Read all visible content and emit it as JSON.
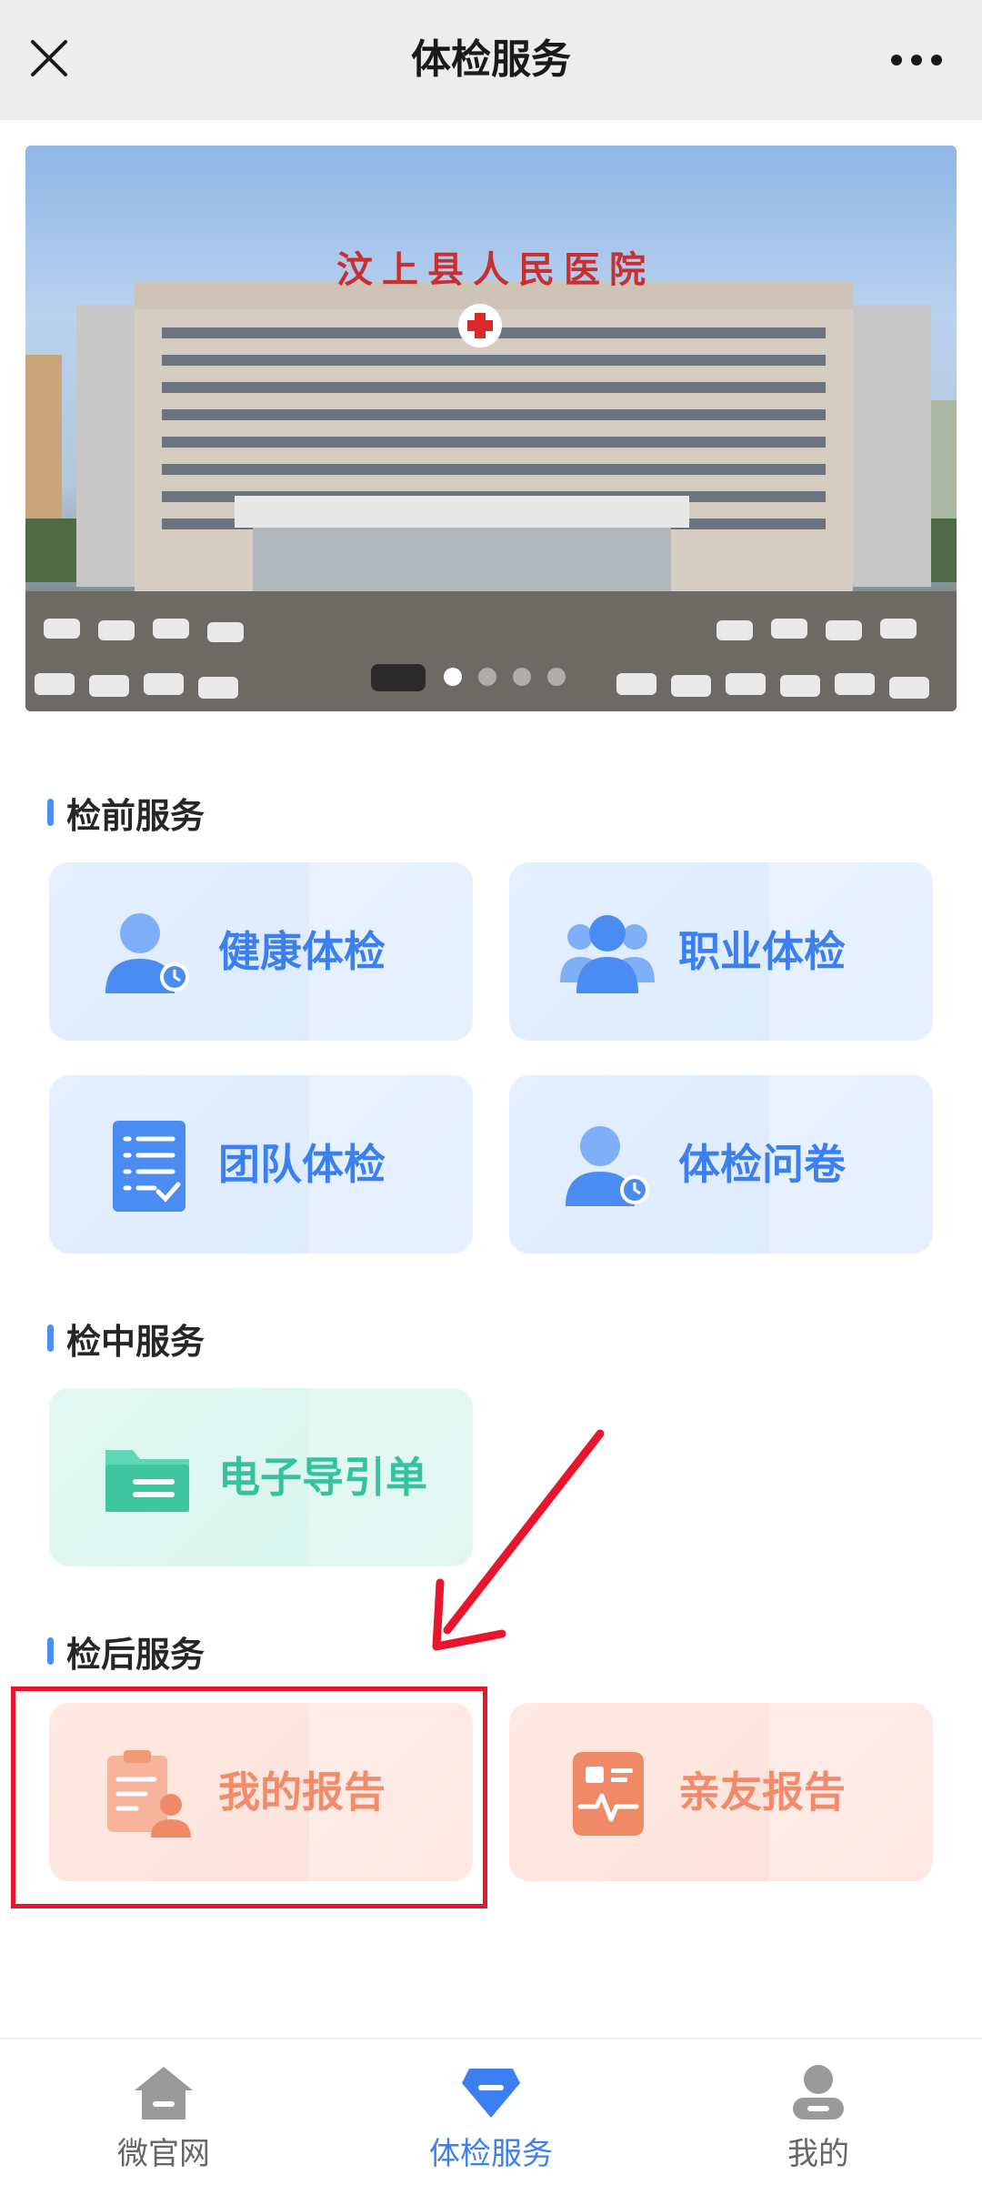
{
  "topbar": {
    "title": "体检服务",
    "close_icon": "close-icon",
    "more_icon": "more-dots-icon"
  },
  "banner": {
    "image": "hospital-building-photo",
    "sign_text": "汶 上 县 人 民 医 院",
    "slide_count": 4,
    "active_slide": 1
  },
  "sections": [
    {
      "title": "检前服务",
      "tiles": [
        {
          "label": "健康体检",
          "icon": "person-clock-icon",
          "color": "#3b7ff0"
        },
        {
          "label": "职业体检",
          "icon": "group-users-icon",
          "color": "#3b7ff0"
        },
        {
          "label": "团队体检",
          "icon": "checklist-icon",
          "color": "#3b7ff0"
        },
        {
          "label": "体检问卷",
          "icon": "person-clock-icon",
          "color": "#3b7ff0"
        }
      ]
    },
    {
      "title": "检中服务",
      "tiles": [
        {
          "label": "电子导引单",
          "icon": "folder-icon",
          "color": "#35c39f"
        }
      ]
    },
    {
      "title": "检后服务",
      "tiles": [
        {
          "label": "我的报告",
          "icon": "report-person-icon",
          "color": "#f28b6b"
        },
        {
          "label": "亲友报告",
          "icon": "health-report-icon",
          "color": "#f28b6b"
        }
      ]
    }
  ],
  "annotation": {
    "arrow_color": "#e8152c",
    "highlight_target": "我的报告"
  },
  "tabbar": {
    "items": [
      {
        "label": "微官网",
        "icon": "home-icon",
        "active": false
      },
      {
        "label": "体检服务",
        "icon": "checkup-icon",
        "active": true
      },
      {
        "label": "我的",
        "icon": "user-icon",
        "active": false
      }
    ],
    "active_color": "#3b7ff0"
  }
}
